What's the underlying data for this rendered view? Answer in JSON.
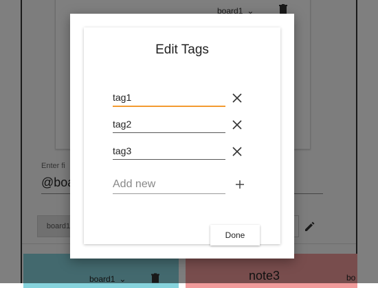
{
  "background": {
    "top_card": {
      "board_select": "board1"
    },
    "filter": {
      "label": "Enter fi",
      "value": "@boa"
    },
    "left_button": "board1",
    "notes": [
      {
        "board_select": "board1",
        "color": "#86d3dc"
      },
      {
        "title": "note3",
        "board_select_partial": "bo",
        "color": "#f19b9b"
      }
    ]
  },
  "dialog": {
    "title": "Edit Tags",
    "tags": [
      "tag1",
      "tag2",
      "tag3"
    ],
    "new_tag_placeholder": "Add new",
    "done_label": "Done",
    "focus_color": "#f39a2e"
  }
}
